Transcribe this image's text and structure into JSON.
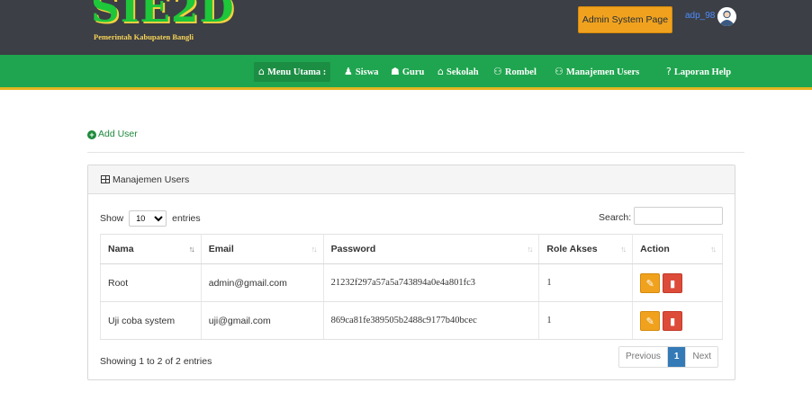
{
  "header": {
    "logo_text": "SIE2D",
    "logo_subtitle": "Pemerintah Kabupaten Bangli",
    "admin_button": "Admin System Page",
    "username": "adp_98"
  },
  "nav": {
    "items": [
      {
        "label": "Menu Utama :",
        "icon": "home-icon",
        "glyph": "⌂"
      },
      {
        "label": "Siswa",
        "icon": "users-icon",
        "glyph": "♟"
      },
      {
        "label": "Guru",
        "icon": "graduation-cap-icon",
        "glyph": "☗"
      },
      {
        "label": "Sekolah",
        "icon": "building-icon",
        "glyph": "⌂"
      },
      {
        "label": "Rombel",
        "icon": "group-icon",
        "glyph": "⚇"
      },
      {
        "label": "Manajemen Users",
        "icon": "group-icon",
        "glyph": "⚇"
      },
      {
        "label": "Laporan Help",
        "icon": "question-icon",
        "glyph": "?"
      }
    ]
  },
  "add_user_label": "Add User",
  "panel": {
    "title": "Manajemen Users",
    "show_label": "Show",
    "entries_value": "10",
    "entries_label": "entries",
    "search_label": "Search:",
    "search_value": ""
  },
  "table": {
    "columns": [
      "Nama",
      "Email",
      "Password",
      "Role Akses",
      "Action"
    ],
    "rows": [
      {
        "nama": "Root",
        "email": "admin@gmail.com",
        "password": "21232f297a57a5a743894a0e4a801fc3",
        "role": "1"
      },
      {
        "nama": "Uji coba system",
        "email": "uji@gmail.com",
        "password": "869ca81fe389505b2488c9177b40bcec",
        "role": "1"
      }
    ]
  },
  "footer": {
    "info": "Showing 1 to 2 of 2 entries",
    "previous": "Previous",
    "page": "1",
    "next": "Next"
  },
  "colors": {
    "header_bg": "#3c3f45",
    "nav_bg": "#1fa54f",
    "accent_orange": "#f0a21e",
    "danger_red": "#dd4b39",
    "pager_active": "#337ab7"
  }
}
